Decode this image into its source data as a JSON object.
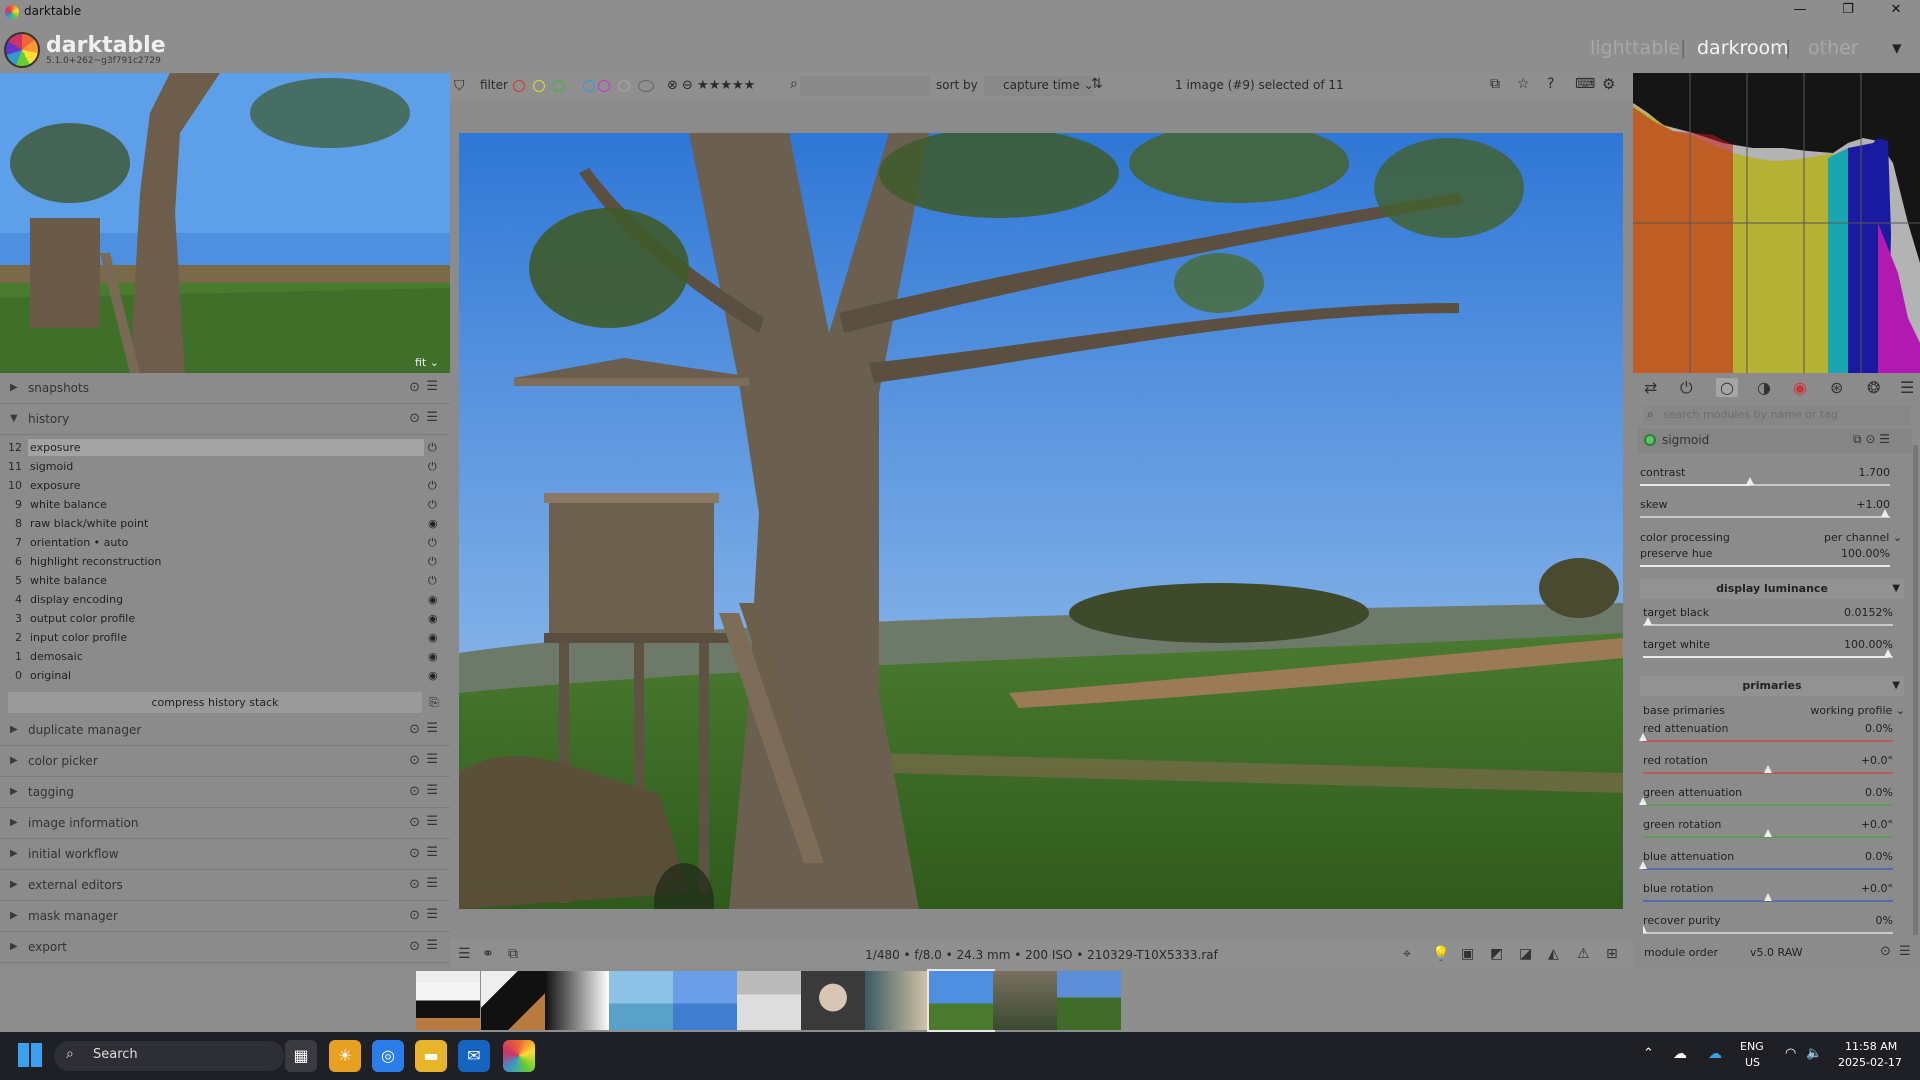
{
  "window": {
    "title": "darktable",
    "btn_min": "—",
    "btn_max": "❐",
    "btn_close": "✕"
  },
  "header": {
    "app_name": "darktable",
    "version": "5.1.0+262~g3f791c2729",
    "views": [
      "lighttable",
      "darkroom",
      "other"
    ],
    "sep": "|",
    "views_menu": "▾"
  },
  "left": {
    "navigation_fit": "fit ⌄",
    "snapshots": "snapshots",
    "history": "history",
    "history_items": [
      {
        "n": "12",
        "label": "exposure",
        "state": "⏻"
      },
      {
        "n": "11",
        "label": "sigmoid",
        "state": "⏻"
      },
      {
        "n": "10",
        "label": "exposure",
        "state": "⏻"
      },
      {
        "n": "9",
        "label": "white balance",
        "state": "⏻"
      },
      {
        "n": "8",
        "label": "raw black/white point",
        "state": "◉"
      },
      {
        "n": "7",
        "label": "orientation • auto",
        "state": "⏻"
      },
      {
        "n": "6",
        "label": "highlight reconstruction",
        "state": "⏻"
      },
      {
        "n": "5",
        "label": "white balance",
        "state": "⏻"
      },
      {
        "n": "4",
        "label": "display encoding",
        "state": "◉"
      },
      {
        "n": "3",
        "label": "output color profile",
        "state": "◉"
      },
      {
        "n": "2",
        "label": "input color profile",
        "state": "◉"
      },
      {
        "n": "1",
        "label": "demosaic",
        "state": "◉"
      },
      {
        "n": "0",
        "label": "original",
        "state": "◉"
      }
    ],
    "compress": "compress history stack",
    "modules": [
      "duplicate manager",
      "color picker",
      "tagging",
      "image information",
      "initial workflow",
      "external editors",
      "mask manager",
      "export"
    ],
    "mod_arrow": "▶",
    "hist_arrow": "▼",
    "reset_icon": "⊙",
    "presets_icon": "☰"
  },
  "toolbar": {
    "filter": "filter",
    "stars": "⊗ ⊖ ★★★★★",
    "sort_by": "sort by",
    "sort_value": "capture time ⌄",
    "selection": "1 image (#9) selected of 11",
    "filter_colors": [
      "#d33",
      "#dd3",
      "#3b3",
      "#39d",
      "#c3c",
      "#aaa",
      "#666"
    ]
  },
  "infobar": {
    "exif": "1/480 • f/8.0 • 24.3 mm • 200 ISO • 210329-T10X5333.raf"
  },
  "right": {
    "search_placeholder": "search modules by name or tag",
    "module": "sigmoid",
    "contrast": {
      "label": "contrast",
      "value": "1.700",
      "level": 0.44
    },
    "skew": {
      "label": "skew",
      "value": "+1.00",
      "level": 0.98
    },
    "color_processing": {
      "label": "color processing",
      "value": "per channel ⌄"
    },
    "preserve_hue": {
      "label": "preserve hue",
      "value": "100.00%",
      "level": 1.0
    },
    "display_luminance": "display luminance",
    "target_black": {
      "label": "target black",
      "value": "0.0152%",
      "level": 0.02
    },
    "target_white": {
      "label": "target white",
      "value": "100.00%",
      "level": 0.98
    },
    "primaries": "primaries",
    "base_primaries": {
      "label": "base primaries",
      "value": "working profile ⌄"
    },
    "red_attenuation": {
      "label": "red attenuation",
      "value": "0.0%",
      "level": 0.0
    },
    "red_rotation": {
      "label": "red rotation",
      "value": "+0.0°",
      "level": 0.5
    },
    "green_attenuation": {
      "label": "green attenuation",
      "value": "0.0%",
      "level": 0.0
    },
    "green_rotation": {
      "label": "green rotation",
      "value": "+0.0°",
      "level": 0.5
    },
    "blue_attenuation": {
      "label": "blue attenuation",
      "value": "0.0%",
      "level": 0.0
    },
    "blue_rotation": {
      "label": "blue rotation",
      "value": "+0.0°",
      "level": 0.5
    },
    "recover_purity": {
      "label": "recover purity",
      "value": "0%",
      "level": 0.0
    },
    "module_order": "module order",
    "module_order_value": "v5.0 RAW",
    "section_tri": "▼"
  },
  "taskbar": {
    "search": "Search",
    "lang1": "ENG",
    "lang2": "US",
    "time": "11:58 AM",
    "date": "2025-02-17",
    "icons": {
      "start": "windows-icon",
      "search": "search-icon"
    }
  }
}
